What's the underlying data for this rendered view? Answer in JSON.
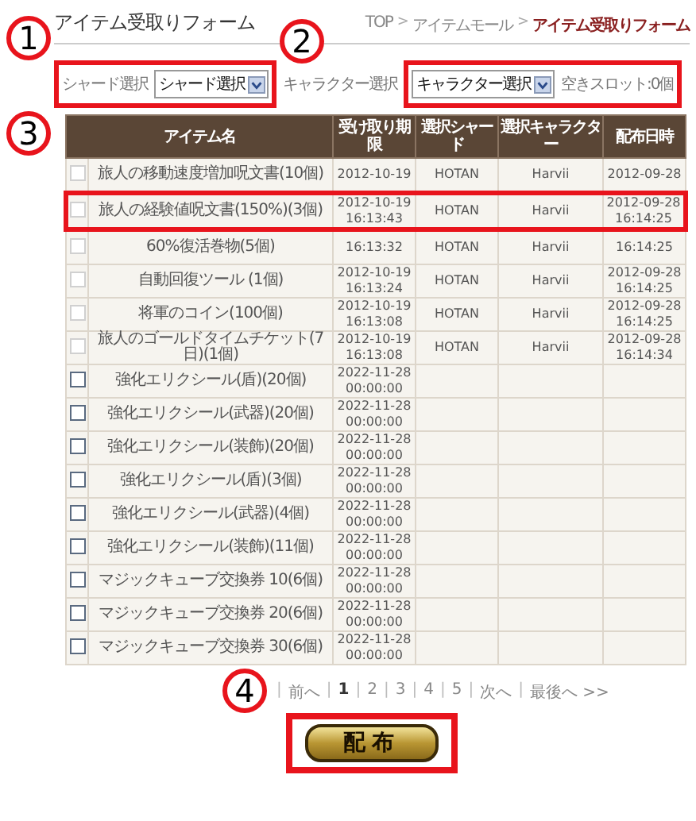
{
  "title": "アイテム受取りフォーム",
  "breadcrumb_separators": [
    ">",
    ">"
  ],
  "breadcrumb": [
    {
      "label": "TOP",
      "current": false
    },
    {
      "label": "アイテムモール",
      "current": false
    },
    {
      "label": "アイテム受取りフォーム",
      "current": true
    }
  ],
  "filters": {
    "shard_label": "シャード選択",
    "shard_value": "シャード選択",
    "character_label": "キャラクター選択",
    "character_value": "キャラクター選択",
    "free_slots": "空きスロット:0個"
  },
  "table": {
    "columns": [
      "アイテム名",
      "受け取り期限",
      "選択シャード",
      "選択キャラクター",
      "配布日時"
    ],
    "rows": [
      {
        "name": "旅人の移動速度増加呪文書(10個)",
        "deadline_date": "2012-10-19",
        "shard": "HOTAN",
        "character": "Harvii",
        "dist_date": "2012-09-28",
        "highlighted": false,
        "kind": "old"
      },
      {
        "name": "旅人の経験値呪文書(150%)(3個)",
        "deadline_date": "2012-10-19",
        "deadline_time": "16:13:43",
        "shard": "HOTAN",
        "character": "Harvii",
        "dist_date": "2012-09-28",
        "dist_time": "16:14:25",
        "highlighted": true,
        "kind": "old"
      },
      {
        "name": "60%復活巻物(5個)",
        "deadline_time": "16:13:32",
        "shard": "HOTAN",
        "character": "Harvii",
        "dist_time": "16:14:25",
        "highlighted": false,
        "kind": "old"
      },
      {
        "name": "自動回復ツール (1個)",
        "deadline_date": "2012-10-19",
        "deadline_time": "16:13:24",
        "shard": "HOTAN",
        "character": "Harvii",
        "dist_date": "2012-09-28",
        "dist_time": "16:14:25",
        "highlighted": false,
        "kind": "old"
      },
      {
        "name": "将軍のコイン(100個)",
        "deadline_date": "2012-10-19",
        "deadline_time": "16:13:08",
        "shard": "HOTAN",
        "character": "Harvii",
        "dist_date": "2012-09-28",
        "dist_time": "16:14:25",
        "highlighted": false,
        "kind": "old"
      },
      {
        "name": "旅人のゴールドタイムチケット(7日)(1個)",
        "deadline_date": "2012-10-19",
        "deadline_time": "16:13:08",
        "shard": "HOTAN",
        "character": "Harvii",
        "dist_date": "2012-09-28",
        "dist_time": "16:14:34",
        "highlighted": false,
        "kind": "old"
      },
      {
        "name": "強化エリクシール(盾)(20個)",
        "deadline_date": "2022-11-28",
        "deadline_time": "00:00:00",
        "highlighted": false,
        "kind": "new"
      },
      {
        "name": "強化エリクシール(武器)(20個)",
        "deadline_date": "2022-11-28",
        "deadline_time": "00:00:00",
        "highlighted": false,
        "kind": "new"
      },
      {
        "name": "強化エリクシール(装飾)(20個)",
        "deadline_date": "2022-11-28",
        "deadline_time": "00:00:00",
        "highlighted": false,
        "kind": "new"
      },
      {
        "name": "強化エリクシール(盾)(3個)",
        "deadline_date": "2022-11-28",
        "deadline_time": "00:00:00",
        "highlighted": false,
        "kind": "new"
      },
      {
        "name": "強化エリクシール(武器)(4個)",
        "deadline_date": "2022-11-28",
        "deadline_time": "00:00:00",
        "highlighted": false,
        "kind": "new"
      },
      {
        "name": "強化エリクシール(装飾)(11個)",
        "deadline_date": "2022-11-28",
        "deadline_time": "00:00:00",
        "highlighted": false,
        "kind": "new"
      },
      {
        "name": "マジックキューブ交換券 10(6個)",
        "deadline_date": "2022-11-28",
        "deadline_time": "00:00:00",
        "highlighted": false,
        "kind": "new"
      },
      {
        "name": "マジックキューブ交換券 20(6個)",
        "deadline_date": "2022-11-28",
        "deadline_time": "00:00:00",
        "highlighted": false,
        "kind": "new"
      },
      {
        "name": "マジックキューブ交換券 30(6個)",
        "deadline_date": "2022-11-28",
        "deadline_time": "00:00:00",
        "highlighted": false,
        "kind": "new"
      }
    ]
  },
  "pagination": {
    "separators": [
      "|",
      "|",
      "|",
      "|",
      "|",
      "|",
      "|",
      "|"
    ],
    "prev": "前へ",
    "pages": [
      {
        "label": "1",
        "selected": true
      },
      {
        "label": "2",
        "selected": false
      },
      {
        "label": "3",
        "selected": false
      },
      {
        "label": "4",
        "selected": false
      },
      {
        "label": "5",
        "selected": false
      }
    ],
    "next": "次へ",
    "last": "最後へ >>"
  },
  "button": "配布",
  "annotations": [
    "1",
    "2",
    "3",
    "4"
  ]
}
